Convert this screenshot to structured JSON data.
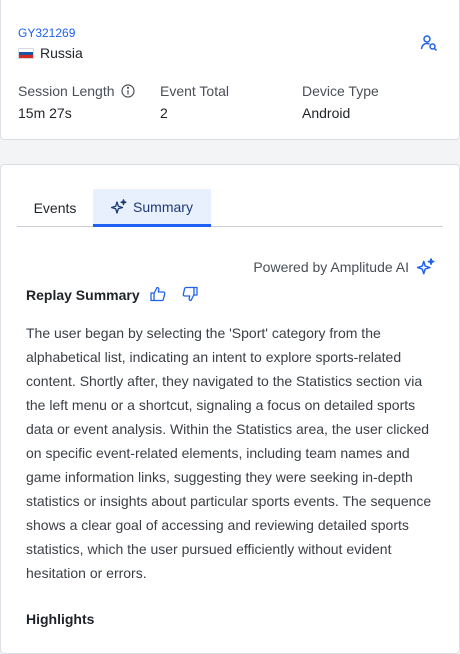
{
  "user": {
    "id": "GY321269",
    "country": "Russia",
    "flag_colors": [
      "#ffffff",
      "#1c57a7",
      "#d52b1e"
    ]
  },
  "stats": [
    {
      "label": "Session Length",
      "value": "15m 27s",
      "has_info_icon": true
    },
    {
      "label": "Event Total",
      "value": "2"
    },
    {
      "label": "Device Type",
      "value": "Android"
    }
  ],
  "tabs": [
    {
      "label": "Events",
      "active": false
    },
    {
      "label": "Summary",
      "active": true
    }
  ],
  "ai": {
    "powered_by": "Powered by Amplitude AI"
  },
  "summary": {
    "title": "Replay Summary",
    "text": "The user began by selecting the 'Sport' category from the alphabetical list, indicating an intent to explore sports-related content. Shortly after, they navigated to the Statistics section via the left menu or a shortcut, signaling a focus on detailed sports data or event analysis. Within the Statistics area, the user clicked on specific event-related elements, including team names and game information links, suggesting they were seeking in-depth statistics or insights about particular sports events. The sequence shows a clear goal of accessing and reviewing detailed sports statistics, which the user pursued efficiently without evident hesitation or errors.",
    "highlights_title": "Highlights"
  },
  "colors": {
    "accent": "#1e61f0",
    "tab_active_bg": "#e8f0fe",
    "text": "#1f2328",
    "muted": "#4a4f57"
  },
  "icons": {
    "user_search": "user-search-icon",
    "info": "info-icon",
    "sparkle": "sparkle-icon",
    "thumbs_up": "thumbs-up-icon",
    "thumbs_down": "thumbs-down-icon"
  }
}
